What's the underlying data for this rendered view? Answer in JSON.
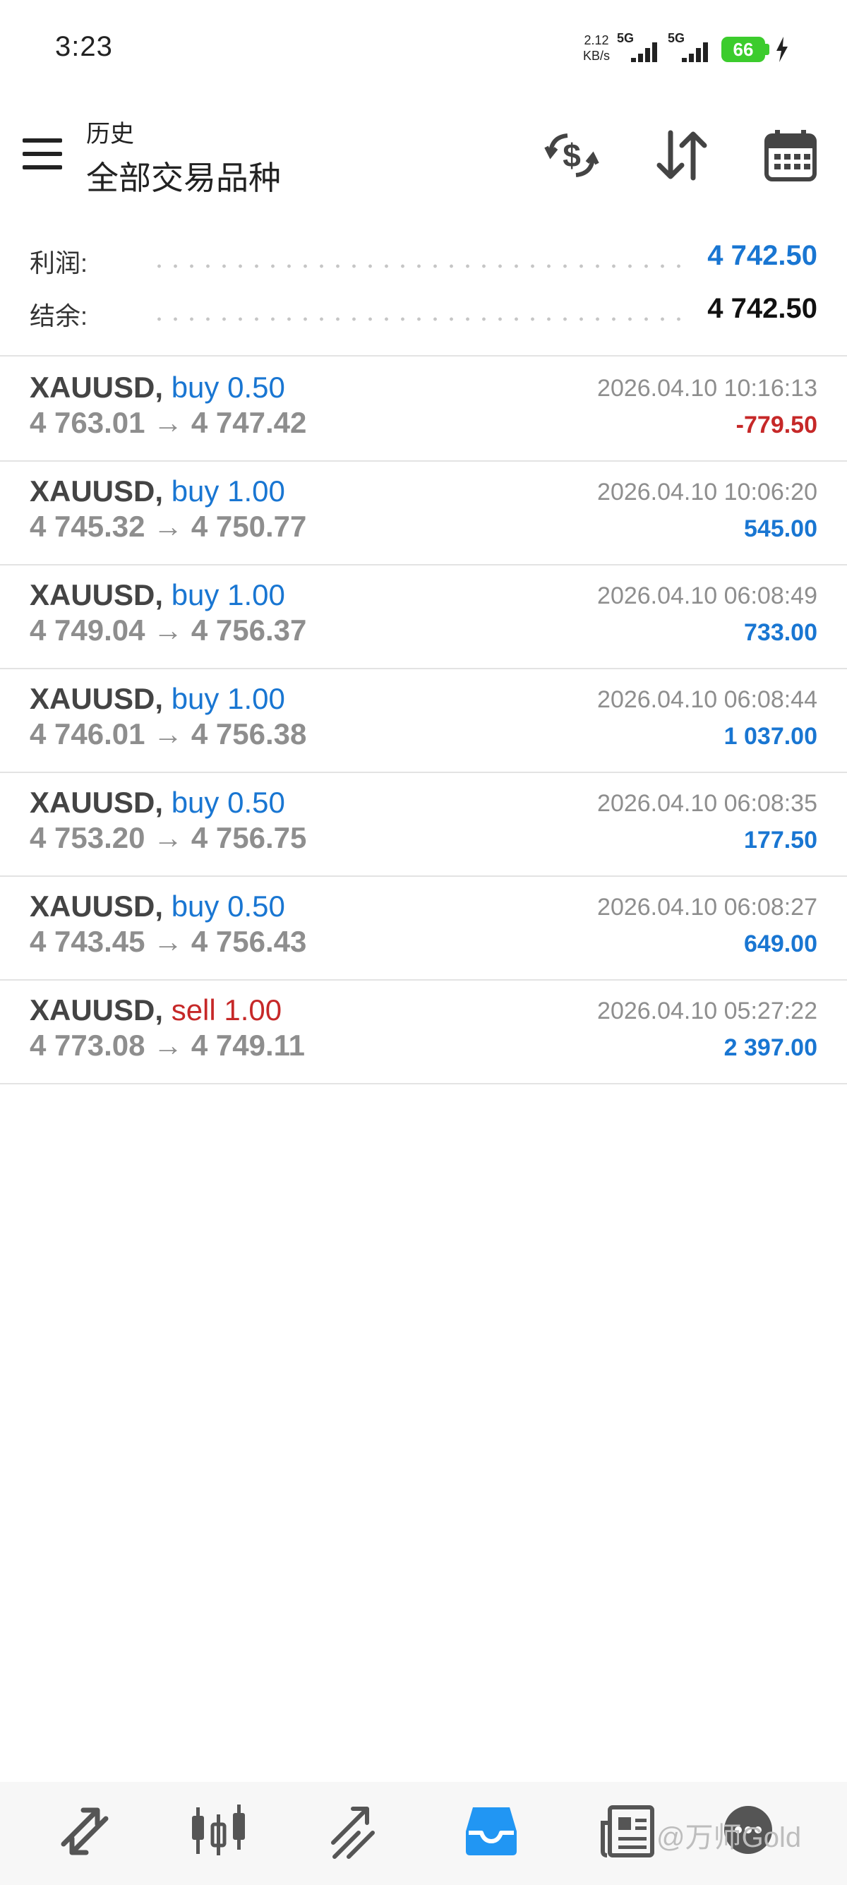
{
  "status_bar": {
    "time": "3:23",
    "net_speed_value": "2.12",
    "net_speed_unit": "KB/s",
    "signal_1": "5G",
    "signal_2": "5G",
    "battery": "66"
  },
  "header": {
    "subtitle": "历史",
    "title": "全部交易品种",
    "icons": [
      "menu-icon",
      "currency-exchange-icon",
      "sort-icon",
      "calendar-icon"
    ]
  },
  "summary": {
    "profit_label": "利润:",
    "profit_value": "4 742.50",
    "balance_label": "结余:",
    "balance_value": "4 742.50"
  },
  "deals": [
    {
      "symbol": "XAUUSD,",
      "side": "buy 0.50",
      "open": "4 763.01",
      "arrow": "→",
      "close": "4 747.42",
      "time": "2026.04.10 10:16:13",
      "profit": "-779.50"
    },
    {
      "symbol": "XAUUSD,",
      "side": "buy 1.00",
      "open": "4 745.32",
      "arrow": "→",
      "close": "4 750.77",
      "time": "2026.04.10 10:06:20",
      "profit": "545.00"
    },
    {
      "symbol": "XAUUSD,",
      "side": "buy 1.00",
      "open": "4 749.04",
      "arrow": "→",
      "close": "4 756.37",
      "time": "2026.04.10 06:08:49",
      "profit": "733.00"
    },
    {
      "symbol": "XAUUSD,",
      "side": "buy 1.00",
      "open": "4 746.01",
      "arrow": "→",
      "close": "4 756.38",
      "time": "2026.04.10 06:08:44",
      "profit": "1 037.00"
    },
    {
      "symbol": "XAUUSD,",
      "side": "buy 0.50",
      "open": "4 753.20",
      "arrow": "→",
      "close": "4 756.75",
      "time": "2026.04.10 06:08:35",
      "profit": "177.50"
    },
    {
      "symbol": "XAUUSD,",
      "side": "buy 0.50",
      "open": "4 743.45",
      "arrow": "→",
      "close": "4 756.43",
      "time": "2026.04.10 06:08:27",
      "profit": "649.00"
    },
    {
      "symbol": "XAUUSD,",
      "side": "sell 1.00",
      "open": "4 773.08",
      "arrow": "→",
      "close": "4 749.11",
      "time": "2026.04.10 05:27:22",
      "profit": "2 397.00"
    }
  ],
  "bottom_nav": {
    "items": [
      "quotes-icon",
      "chart-icon",
      "trade-icon",
      "history-icon",
      "news-icon",
      "chat-icon"
    ],
    "active": "history-icon",
    "watermark": "@万师Gold"
  },
  "colors": {
    "buy": "#1976d2",
    "sell": "#c62828",
    "profit_positive": "#1976d2",
    "profit_negative": "#c62828",
    "active_nav": "#2196f3",
    "battery": "#3ccc2d"
  }
}
